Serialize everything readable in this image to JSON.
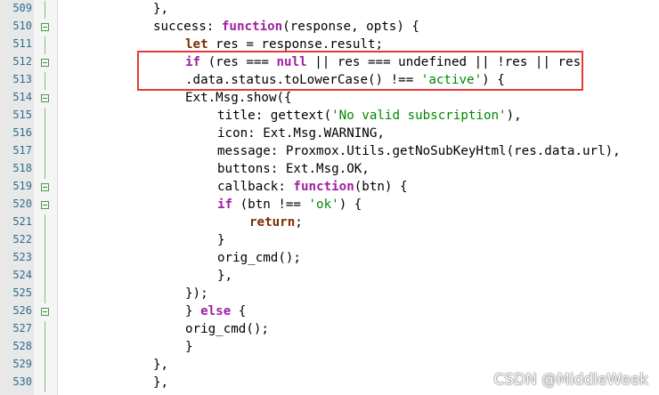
{
  "editor": {
    "lines": [
      {
        "no": "509",
        "fold": false,
        "indent": 3,
        "tokens": [
          {
            "t": "},",
            "c": ""
          }
        ]
      },
      {
        "no": "510",
        "fold": true,
        "indent": 3,
        "tokens": [
          {
            "t": "success: ",
            "c": ""
          },
          {
            "t": "function",
            "c": "k"
          },
          {
            "t": "(response, opts) {",
            "c": ""
          }
        ]
      },
      {
        "no": "511",
        "fold": false,
        "indent": 4,
        "tokens": [
          {
            "t": "let",
            "c": "f"
          },
          {
            "t": " res = response.result;",
            "c": ""
          }
        ]
      },
      {
        "no": "512",
        "fold": true,
        "indent": 4,
        "tokens": [
          {
            "t": "if",
            "c": "k"
          },
          {
            "t": " (res === ",
            "c": ""
          },
          {
            "t": "null",
            "c": "k"
          },
          {
            "t": " || res === undefined || !res || res",
            "c": ""
          }
        ]
      },
      {
        "no": "513",
        "fold": false,
        "indent": 4,
        "tokens": [
          {
            "t": ".data.status.toLowerCase() !== ",
            "c": ""
          },
          {
            "t": "'active'",
            "c": "s"
          },
          {
            "t": ") {",
            "c": ""
          }
        ]
      },
      {
        "no": "514",
        "fold": true,
        "indent": 4,
        "tokens": [
          {
            "t": "Ext.Msg.show({",
            "c": ""
          }
        ]
      },
      {
        "no": "515",
        "fold": false,
        "indent": 5,
        "tokens": [
          {
            "t": "title: gettext(",
            "c": ""
          },
          {
            "t": "'No valid subscription'",
            "c": "s"
          },
          {
            "t": "),",
            "c": ""
          }
        ]
      },
      {
        "no": "516",
        "fold": false,
        "indent": 5,
        "tokens": [
          {
            "t": "icon: Ext.Msg.WARNING,",
            "c": ""
          }
        ]
      },
      {
        "no": "517",
        "fold": false,
        "indent": 5,
        "tokens": [
          {
            "t": "message: Proxmox.Utils.getNoSubKeyHtml(res.data.url),",
            "c": ""
          }
        ]
      },
      {
        "no": "518",
        "fold": false,
        "indent": 5,
        "tokens": [
          {
            "t": "buttons: Ext.Msg.OK,",
            "c": ""
          }
        ]
      },
      {
        "no": "519",
        "fold": true,
        "indent": 5,
        "tokens": [
          {
            "t": "callback: ",
            "c": ""
          },
          {
            "t": "function",
            "c": "k"
          },
          {
            "t": "(btn) {",
            "c": ""
          }
        ]
      },
      {
        "no": "520",
        "fold": true,
        "indent": 5,
        "tokens": [
          {
            "t": "if",
            "c": "k"
          },
          {
            "t": " (btn !== ",
            "c": ""
          },
          {
            "t": "'ok'",
            "c": "s"
          },
          {
            "t": ") {",
            "c": ""
          }
        ]
      },
      {
        "no": "521",
        "fold": false,
        "indent": 6,
        "tokens": [
          {
            "t": "return",
            "c": "f"
          },
          {
            "t": ";",
            "c": ""
          }
        ]
      },
      {
        "no": "522",
        "fold": false,
        "indent": 5,
        "tokens": [
          {
            "t": "}",
            "c": ""
          }
        ]
      },
      {
        "no": "523",
        "fold": false,
        "indent": 5,
        "tokens": [
          {
            "t": "orig_cmd();",
            "c": ""
          }
        ]
      },
      {
        "no": "524",
        "fold": false,
        "indent": 5,
        "tokens": [
          {
            "t": "},",
            "c": ""
          }
        ]
      },
      {
        "no": "525",
        "fold": false,
        "indent": 4,
        "tokens": [
          {
            "t": "});",
            "c": ""
          }
        ]
      },
      {
        "no": "526",
        "fold": true,
        "indent": 4,
        "tokens": [
          {
            "t": "} ",
            "c": ""
          },
          {
            "t": "else",
            "c": "k"
          },
          {
            "t": " {",
            "c": ""
          }
        ]
      },
      {
        "no": "527",
        "fold": false,
        "indent": 4,
        "tokens": [
          {
            "t": "orig_cmd();",
            "c": ""
          }
        ]
      },
      {
        "no": "528",
        "fold": false,
        "indent": 4,
        "tokens": [
          {
            "t": "}",
            "c": ""
          }
        ]
      },
      {
        "no": "529",
        "fold": false,
        "indent": 3,
        "tokens": [
          {
            "t": "},",
            "c": ""
          }
        ]
      },
      {
        "no": "530",
        "fold": false,
        "indent": 3,
        "tokens": [
          {
            "t": "},",
            "c": ""
          }
        ]
      }
    ]
  },
  "watermark": "CSDN @MiddleWeek",
  "colors": {
    "keyword": "#a020a0",
    "function_keyword": "#7a2c00",
    "string": "#008800",
    "line_number": "#2b6e8f",
    "highlight_box": "#e53935",
    "fold_marker": "#4c9a4c"
  }
}
